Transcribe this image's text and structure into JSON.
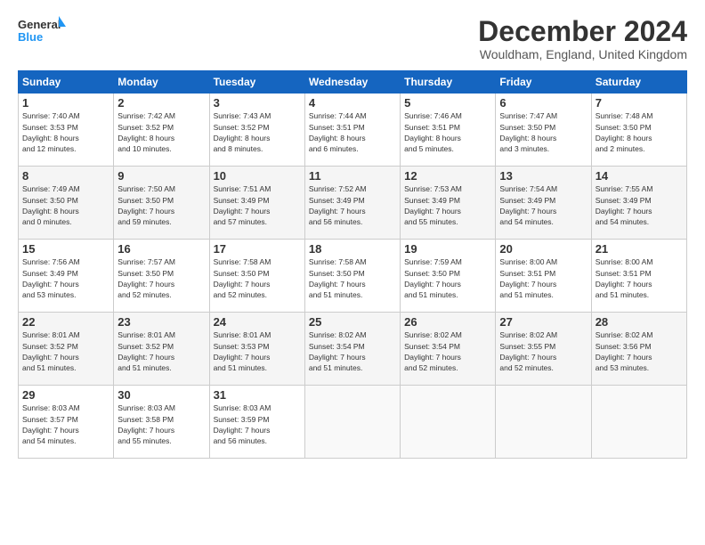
{
  "header": {
    "logo_line1": "General",
    "logo_line2": "Blue",
    "title": "December 2024",
    "location": "Wouldham, England, United Kingdom"
  },
  "days_of_week": [
    "Sunday",
    "Monday",
    "Tuesday",
    "Wednesday",
    "Thursday",
    "Friday",
    "Saturday"
  ],
  "weeks": [
    [
      {
        "day": 1,
        "info": "Sunrise: 7:40 AM\nSunset: 3:53 PM\nDaylight: 8 hours\nand 12 minutes."
      },
      {
        "day": 2,
        "info": "Sunrise: 7:42 AM\nSunset: 3:52 PM\nDaylight: 8 hours\nand 10 minutes."
      },
      {
        "day": 3,
        "info": "Sunrise: 7:43 AM\nSunset: 3:52 PM\nDaylight: 8 hours\nand 8 minutes."
      },
      {
        "day": 4,
        "info": "Sunrise: 7:44 AM\nSunset: 3:51 PM\nDaylight: 8 hours\nand 6 minutes."
      },
      {
        "day": 5,
        "info": "Sunrise: 7:46 AM\nSunset: 3:51 PM\nDaylight: 8 hours\nand 5 minutes."
      },
      {
        "day": 6,
        "info": "Sunrise: 7:47 AM\nSunset: 3:50 PM\nDaylight: 8 hours\nand 3 minutes."
      },
      {
        "day": 7,
        "info": "Sunrise: 7:48 AM\nSunset: 3:50 PM\nDaylight: 8 hours\nand 2 minutes."
      }
    ],
    [
      {
        "day": 8,
        "info": "Sunrise: 7:49 AM\nSunset: 3:50 PM\nDaylight: 8 hours\nand 0 minutes."
      },
      {
        "day": 9,
        "info": "Sunrise: 7:50 AM\nSunset: 3:50 PM\nDaylight: 7 hours\nand 59 minutes."
      },
      {
        "day": 10,
        "info": "Sunrise: 7:51 AM\nSunset: 3:49 PM\nDaylight: 7 hours\nand 57 minutes."
      },
      {
        "day": 11,
        "info": "Sunrise: 7:52 AM\nSunset: 3:49 PM\nDaylight: 7 hours\nand 56 minutes."
      },
      {
        "day": 12,
        "info": "Sunrise: 7:53 AM\nSunset: 3:49 PM\nDaylight: 7 hours\nand 55 minutes."
      },
      {
        "day": 13,
        "info": "Sunrise: 7:54 AM\nSunset: 3:49 PM\nDaylight: 7 hours\nand 54 minutes."
      },
      {
        "day": 14,
        "info": "Sunrise: 7:55 AM\nSunset: 3:49 PM\nDaylight: 7 hours\nand 54 minutes."
      }
    ],
    [
      {
        "day": 15,
        "info": "Sunrise: 7:56 AM\nSunset: 3:49 PM\nDaylight: 7 hours\nand 53 minutes."
      },
      {
        "day": 16,
        "info": "Sunrise: 7:57 AM\nSunset: 3:50 PM\nDaylight: 7 hours\nand 52 minutes."
      },
      {
        "day": 17,
        "info": "Sunrise: 7:58 AM\nSunset: 3:50 PM\nDaylight: 7 hours\nand 52 minutes."
      },
      {
        "day": 18,
        "info": "Sunrise: 7:58 AM\nSunset: 3:50 PM\nDaylight: 7 hours\nand 51 minutes."
      },
      {
        "day": 19,
        "info": "Sunrise: 7:59 AM\nSunset: 3:50 PM\nDaylight: 7 hours\nand 51 minutes."
      },
      {
        "day": 20,
        "info": "Sunrise: 8:00 AM\nSunset: 3:51 PM\nDaylight: 7 hours\nand 51 minutes."
      },
      {
        "day": 21,
        "info": "Sunrise: 8:00 AM\nSunset: 3:51 PM\nDaylight: 7 hours\nand 51 minutes."
      }
    ],
    [
      {
        "day": 22,
        "info": "Sunrise: 8:01 AM\nSunset: 3:52 PM\nDaylight: 7 hours\nand 51 minutes."
      },
      {
        "day": 23,
        "info": "Sunrise: 8:01 AM\nSunset: 3:52 PM\nDaylight: 7 hours\nand 51 minutes."
      },
      {
        "day": 24,
        "info": "Sunrise: 8:01 AM\nSunset: 3:53 PM\nDaylight: 7 hours\nand 51 minutes."
      },
      {
        "day": 25,
        "info": "Sunrise: 8:02 AM\nSunset: 3:54 PM\nDaylight: 7 hours\nand 51 minutes."
      },
      {
        "day": 26,
        "info": "Sunrise: 8:02 AM\nSunset: 3:54 PM\nDaylight: 7 hours\nand 52 minutes."
      },
      {
        "day": 27,
        "info": "Sunrise: 8:02 AM\nSunset: 3:55 PM\nDaylight: 7 hours\nand 52 minutes."
      },
      {
        "day": 28,
        "info": "Sunrise: 8:02 AM\nSunset: 3:56 PM\nDaylight: 7 hours\nand 53 minutes."
      }
    ],
    [
      {
        "day": 29,
        "info": "Sunrise: 8:03 AM\nSunset: 3:57 PM\nDaylight: 7 hours\nand 54 minutes."
      },
      {
        "day": 30,
        "info": "Sunrise: 8:03 AM\nSunset: 3:58 PM\nDaylight: 7 hours\nand 55 minutes."
      },
      {
        "day": 31,
        "info": "Sunrise: 8:03 AM\nSunset: 3:59 PM\nDaylight: 7 hours\nand 56 minutes."
      },
      null,
      null,
      null,
      null
    ]
  ]
}
